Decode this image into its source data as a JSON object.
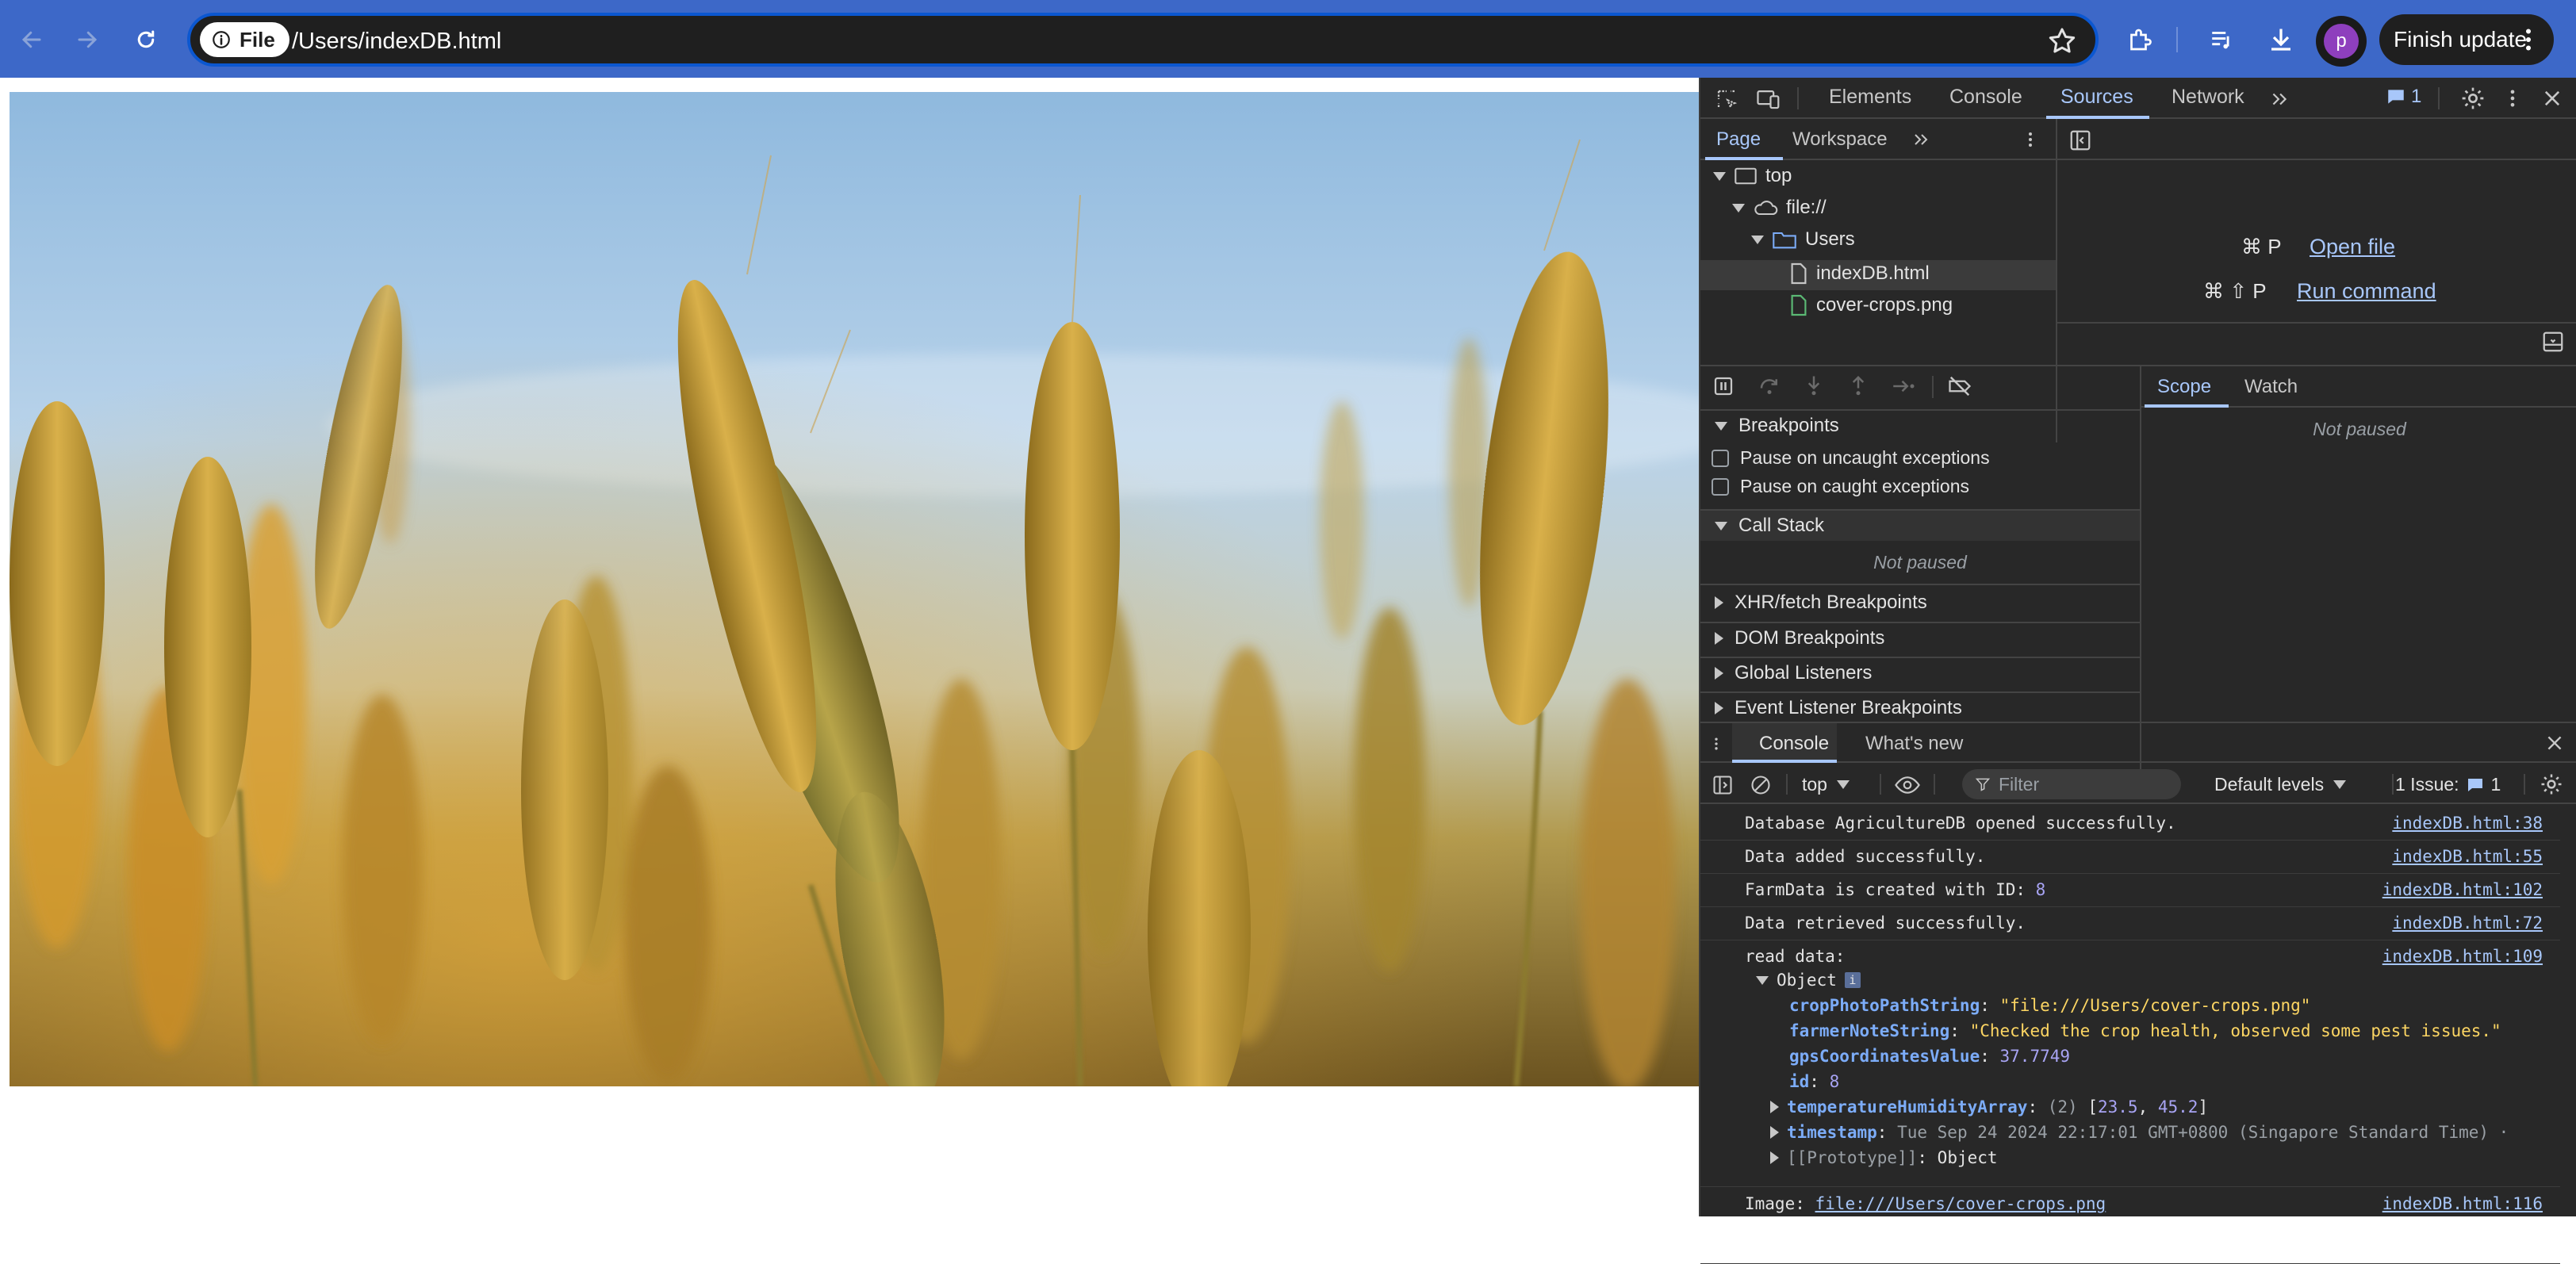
{
  "browser": {
    "chip_label": "File",
    "url": "/Users/indexDB.html",
    "avatar_letter": "p",
    "finish_update_label": "Finish update"
  },
  "devtools": {
    "main_tabs": [
      "Elements",
      "Console",
      "Sources",
      "Network"
    ],
    "issues_count": "1",
    "sources": {
      "sub_tabs": [
        "Page",
        "Workspace"
      ],
      "tree": {
        "top": "top",
        "origin": "file://",
        "folder": "Users",
        "files": [
          "indexDB.html",
          "cover-crops.png"
        ]
      },
      "shortcuts": [
        {
          "keys": "⌘ P",
          "label": "Open file"
        },
        {
          "keys": "⌘ ⇧ P",
          "label": "Run command"
        }
      ]
    },
    "debugger": {
      "breakpoints_label": "Breakpoints",
      "pause_uncaught": "Pause on uncaught exceptions",
      "pause_caught": "Pause on caught exceptions",
      "call_stack_label": "Call Stack",
      "not_paused": "Not paused",
      "collapsed_sections": [
        "XHR/fetch Breakpoints",
        "DOM Breakpoints",
        "Global Listeners",
        "Event Listener Breakpoints"
      ],
      "scope_tab": "Scope",
      "watch_tab": "Watch",
      "scope_status": "Not paused"
    },
    "drawer": {
      "tabs": [
        "Console",
        "What's new"
      ],
      "context": "top",
      "filter_placeholder": "Filter",
      "levels": "Default levels",
      "issues_label": "1 Issue:",
      "issues_count": "1"
    },
    "console": {
      "messages": [
        {
          "text": "Database AgricultureDB opened successfully.",
          "source": "indexDB.html:38"
        },
        {
          "text": "Data added successfully.",
          "source": "indexDB.html:55"
        },
        {
          "text": "FarmData is created with ID: ",
          "value": "8",
          "source": "indexDB.html:102"
        },
        {
          "text": "Data retrieved successfully.",
          "source": "indexDB.html:72"
        },
        {
          "text": "read data:",
          "source": "indexDB.html:109"
        }
      ],
      "object": {
        "label": "Object",
        "info": "i",
        "props": [
          {
            "key": "cropPhotoPathString",
            "value": "\"file:///Users/cover-crops.png\""
          },
          {
            "key": "farmerNoteString",
            "value": "\"Checked the crop health, observed some pest issues.\""
          },
          {
            "key": "gpsCoordinatesValue",
            "value": "37.7749"
          },
          {
            "key": "id",
            "value": "8"
          }
        ],
        "temperature": {
          "key": "temperatureHumidityArray",
          "count": "(2)",
          "open": "[",
          "v1": "23.5",
          "comma": ", ",
          "v2": "45.2",
          "close": "]"
        },
        "timestamp": {
          "key": "timestamp",
          "value": "Tue Sep 24 2024 22:17:01 GMT+0800 (Singapore Standard Time) ·"
        },
        "prototype": {
          "key": "[[Prototype]]",
          "value": "Object"
        }
      },
      "image_line": {
        "label": "Image: ",
        "link": "file:///Users/cover-crops.png",
        "source": "indexDB.html:116"
      }
    }
  }
}
